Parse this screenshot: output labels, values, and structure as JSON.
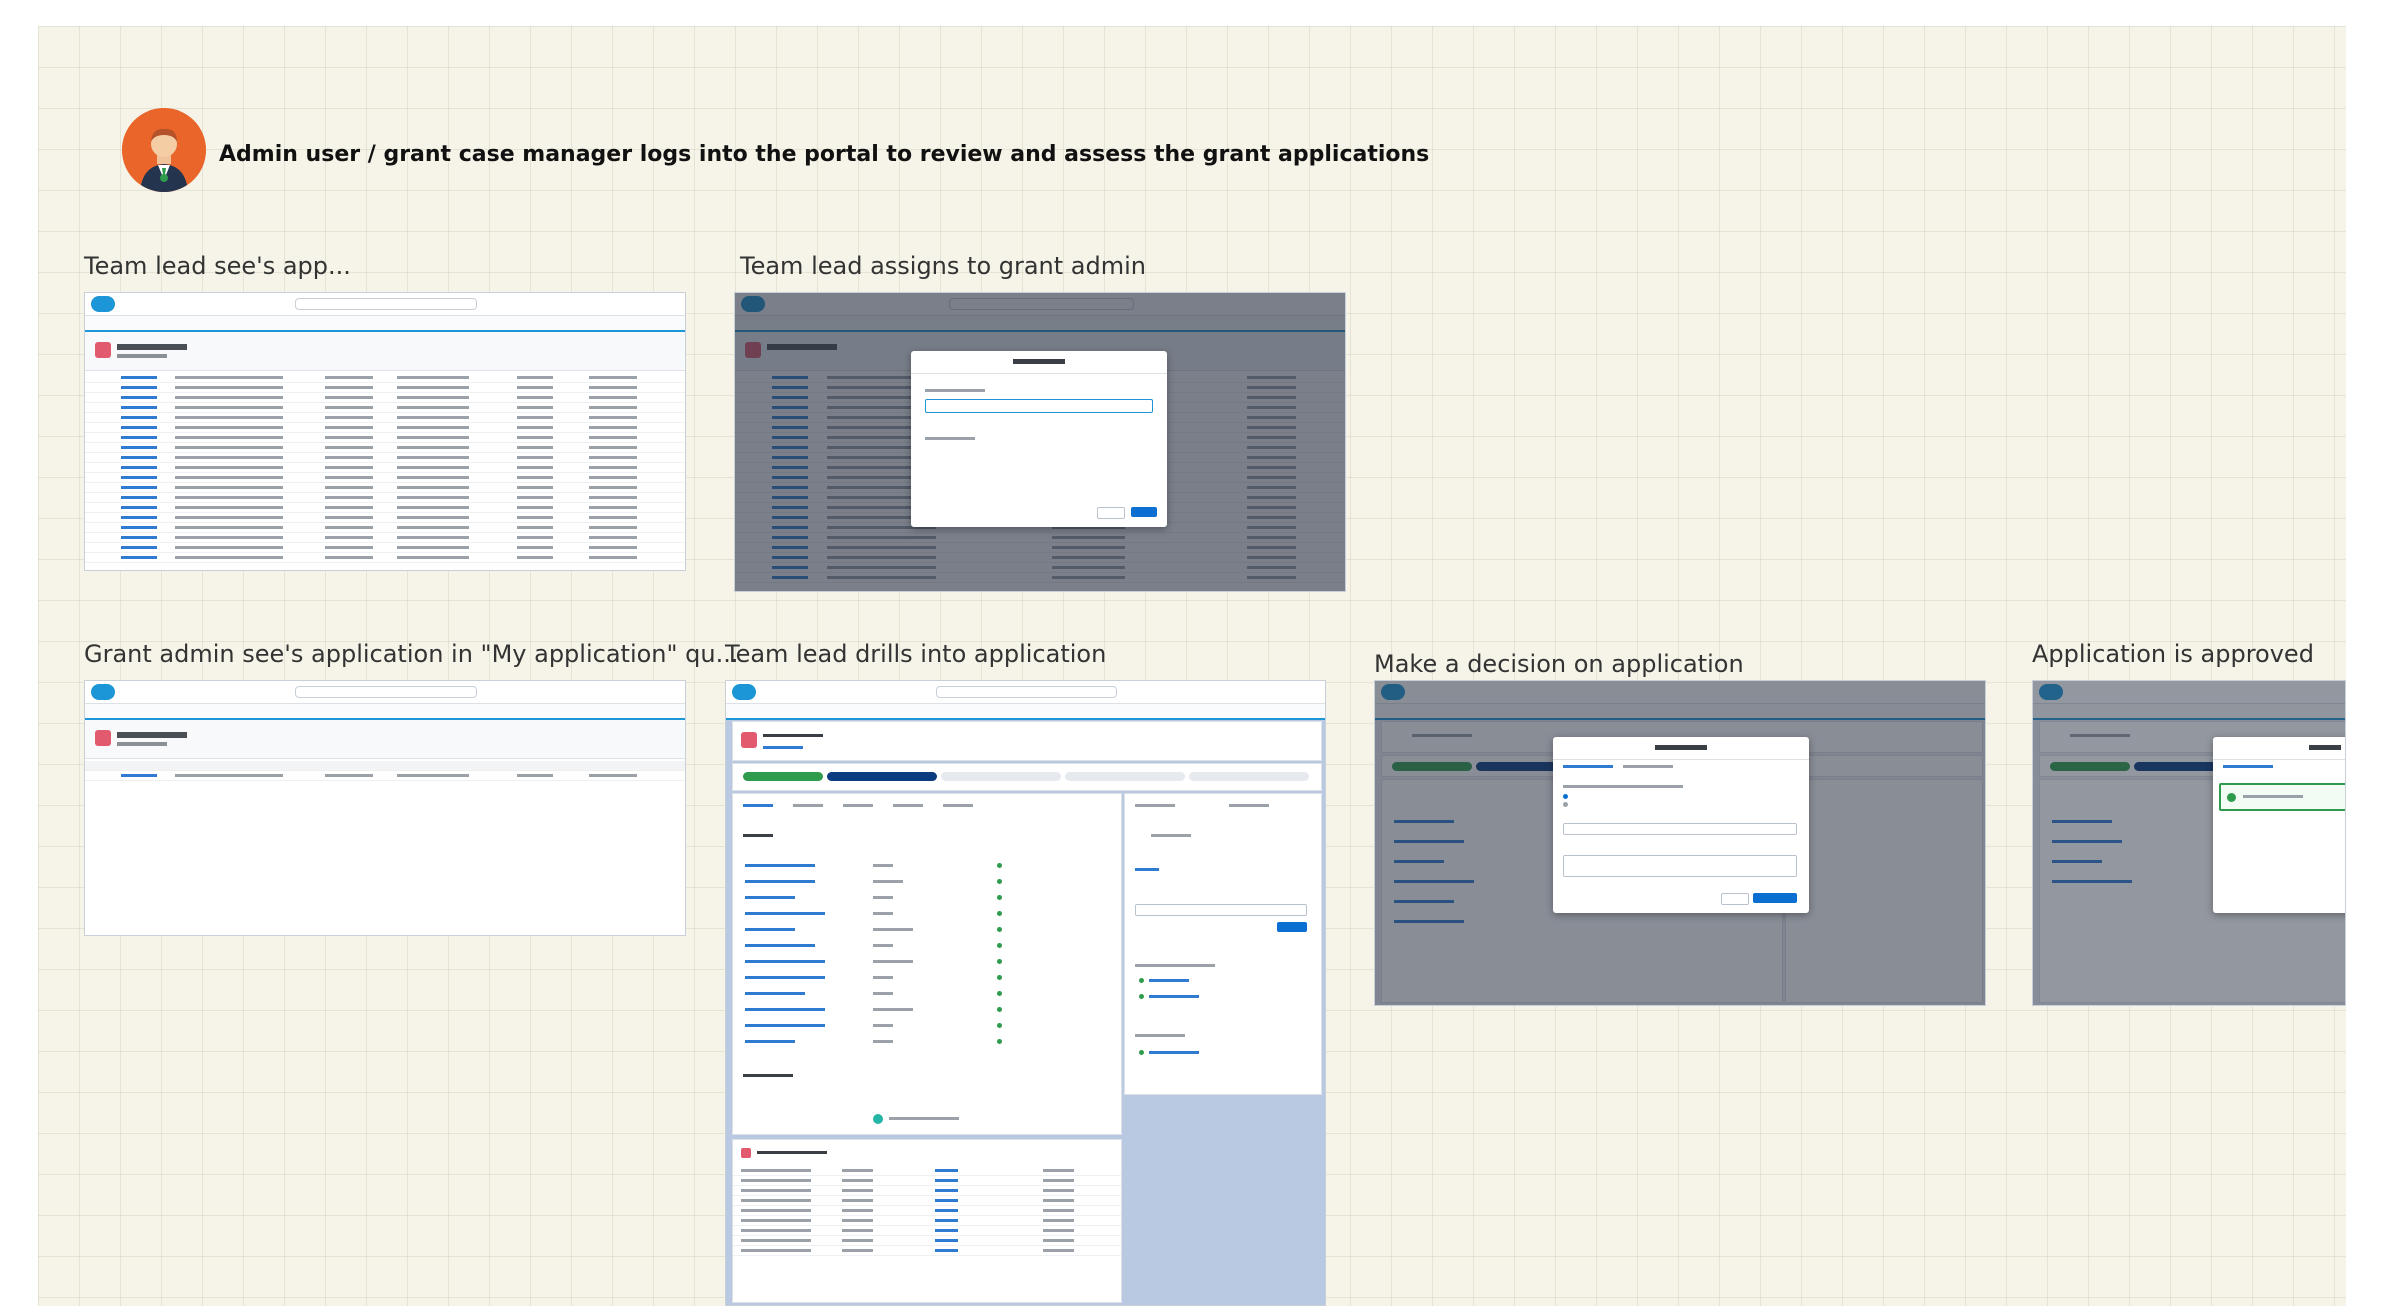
{
  "header": {
    "text": "Admin user / grant case manager logs into the portal to review and assess the grant applications"
  },
  "frames": [
    {
      "label": "Team lead see's app..."
    },
    {
      "label": "Team lead assigns to grant admin"
    },
    {
      "label": "Grant admin see's application in \"My application\" qu..."
    },
    {
      "label": "Team lead drills into application"
    },
    {
      "label": "Make a decision on application"
    },
    {
      "label": "Application is approved"
    }
  ],
  "colors": {
    "board": "#f6f4e8",
    "avatar": "#e9652a",
    "brand": "#1c96d6",
    "success": "#2e9b4d",
    "primary_button": "#0b6fd2"
  },
  "icons": [
    "user-avatar-icon",
    "salesforce-cloud-logo-icon",
    "success-check-icon"
  ]
}
